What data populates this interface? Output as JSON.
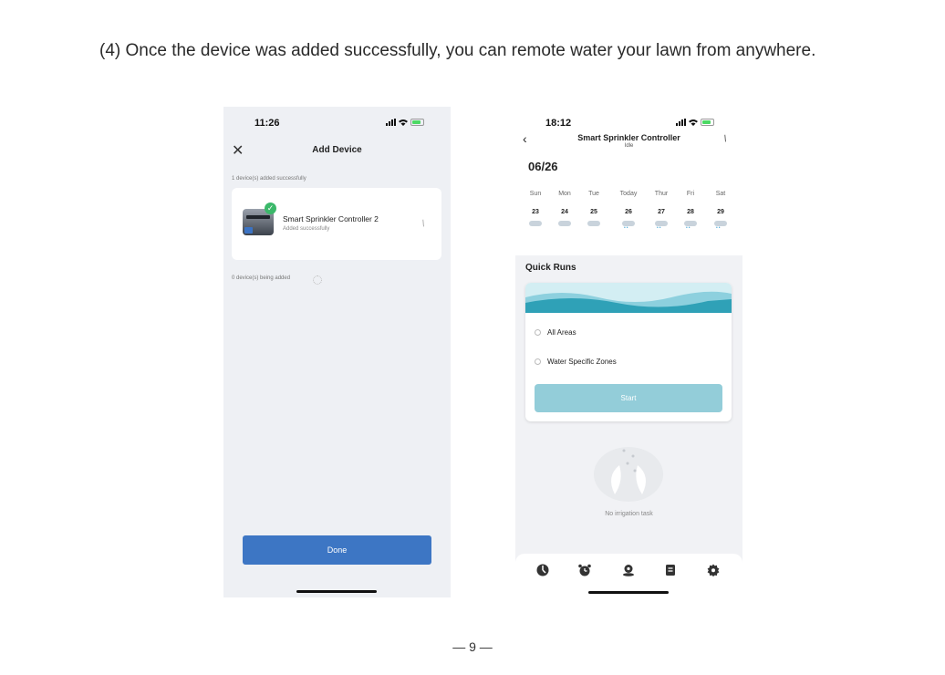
{
  "instruction": "(4) Once the device was added successfully, you can remote water your lawn from anywhere.",
  "phone1": {
    "time": "11:26",
    "close_icon": "close-icon",
    "title": "Add Device",
    "added_count": "1 device(s) added successfully",
    "device": {
      "name": "Smart Sprinkler Controller 2",
      "status": "Added successfully",
      "edit_icon": "pencil-icon"
    },
    "adding_count": "0 device(s) being added",
    "done_label": "Done"
  },
  "phone2": {
    "time": "18:12",
    "title": "Smart Sprinkler Controller",
    "status": "Idle",
    "date": "06/26",
    "calendar": [
      {
        "day": "Sun",
        "num": "23",
        "weather": "cloudy"
      },
      {
        "day": "Mon",
        "num": "24",
        "weather": "cloudy"
      },
      {
        "day": "Tue",
        "num": "25",
        "weather": "cloudy"
      },
      {
        "day": "Today",
        "num": "26",
        "weather": "rain"
      },
      {
        "day": "Thur",
        "num": "27",
        "weather": "rain"
      },
      {
        "day": "Fri",
        "num": "28",
        "weather": "rain"
      },
      {
        "day": "Sat",
        "num": "29",
        "weather": "rain"
      }
    ],
    "quick_runs_title": "Quick Runs",
    "options": [
      "All Areas",
      "Water Specific Zones"
    ],
    "start_label": "Start",
    "empty_text": "No irrigation task",
    "tabs": [
      "dashboard-icon",
      "alarm-clock-icon",
      "zone-map-icon",
      "log-icon",
      "settings-gear-icon"
    ]
  },
  "colors": {
    "done_button": "#3d76c4",
    "start_button": "#93cdd9",
    "wave_accent": "#2fa1b7",
    "success_check": "#3bb86a"
  },
  "page_number": "— 9 —"
}
